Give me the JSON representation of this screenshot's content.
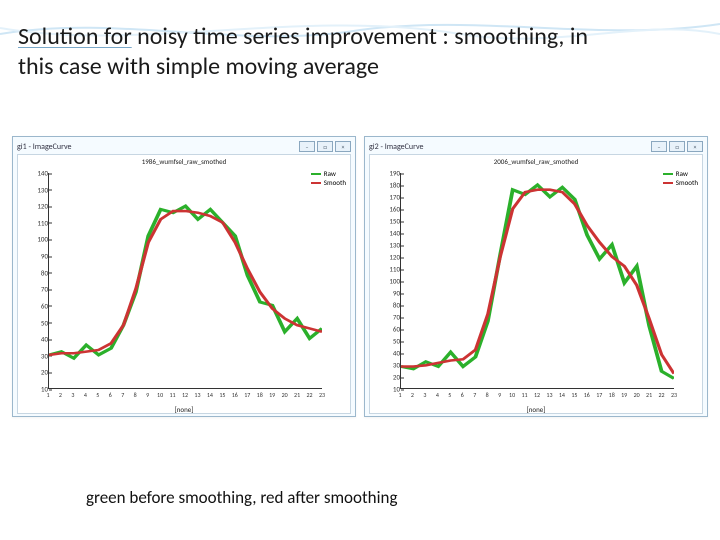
{
  "title": {
    "line1a": "Solution for",
    "line1b": " noisy time series improvement : smoothing, in",
    "line2": "this case with simple moving average"
  },
  "caption": "green before smoothing, red after smoothing",
  "colors": {
    "raw": "#2bb02b",
    "smooth": "#cc3333",
    "panel_border": "#9bb7cc"
  },
  "chart_data": [
    {
      "type": "line",
      "window_title": "gi1 - ImageCurve",
      "title": "1986_wumfsel_raw_smothed",
      "xlabel": "[none]",
      "ylabel": "",
      "ylim": [
        10,
        140
      ],
      "y_ticks": [
        10,
        20,
        30,
        40,
        50,
        60,
        70,
        80,
        90,
        100,
        110,
        120,
        130,
        140
      ],
      "x": [
        1,
        2,
        3,
        4,
        5,
        6,
        7,
        8,
        9,
        10,
        11,
        12,
        13,
        14,
        15,
        16,
        17,
        18,
        19,
        20,
        21,
        22,
        23
      ],
      "series": [
        {
          "name": "Raw",
          "color": "#2bb02b",
          "values": [
            30,
            32,
            28,
            36,
            30,
            34,
            48,
            68,
            102,
            118,
            116,
            120,
            112,
            118,
            110,
            102,
            78,
            62,
            60,
            44,
            52,
            40,
            46
          ]
        },
        {
          "name": "Smooth",
          "color": "#cc3333",
          "values": [
            30,
            31,
            31,
            32,
            33,
            37,
            48,
            70,
            98,
            112,
            117,
            117,
            116,
            114,
            110,
            98,
            82,
            68,
            58,
            52,
            48,
            46,
            44
          ]
        }
      ]
    },
    {
      "type": "line",
      "window_title": "gi2 - ImageCurve",
      "title": "2006_wumfsel_raw_smothed",
      "xlabel": "[none]",
      "ylabel": "",
      "ylim": [
        10,
        190
      ],
      "y_ticks": [
        10,
        20,
        30,
        40,
        50,
        60,
        70,
        80,
        90,
        100,
        110,
        120,
        130,
        140,
        150,
        160,
        170,
        180,
        190
      ],
      "x": [
        1,
        2,
        3,
        4,
        5,
        6,
        7,
        8,
        9,
        10,
        11,
        12,
        13,
        14,
        15,
        16,
        17,
        18,
        19,
        20,
        21,
        22,
        23
      ],
      "series": [
        {
          "name": "Raw",
          "color": "#2bb02b",
          "values": [
            28,
            26,
            32,
            28,
            40,
            28,
            36,
            66,
            122,
            176,
            172,
            180,
            170,
            178,
            168,
            138,
            118,
            130,
            98,
            112,
            62,
            24,
            18
          ]
        },
        {
          "name": "Smooth",
          "color": "#cc3333",
          "values": [
            28,
            28,
            29,
            31,
            33,
            34,
            42,
            72,
            120,
            160,
            174,
            176,
            176,
            174,
            164,
            146,
            132,
            120,
            112,
            96,
            68,
            38,
            22
          ]
        }
      ]
    }
  ]
}
